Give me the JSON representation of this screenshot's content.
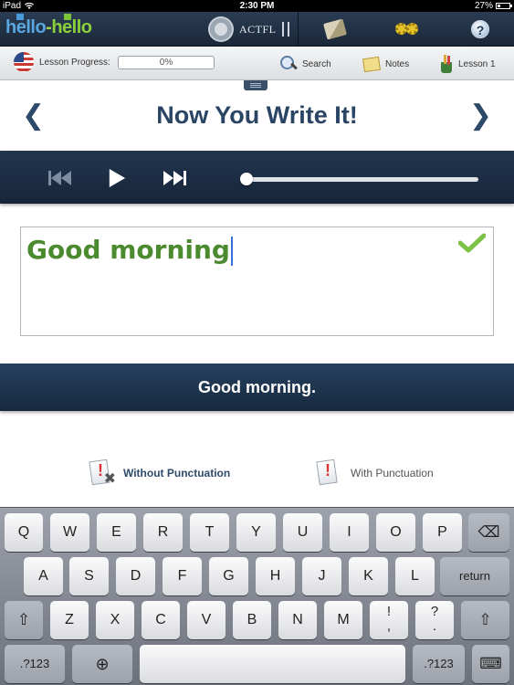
{
  "status_bar": {
    "device": "iPad",
    "time": "2:30 PM",
    "battery": "27%"
  },
  "top_nav": {
    "logo_part1": "hello",
    "logo_dash": "-",
    "logo_part2": "hello",
    "actfl_label": "ACTFL",
    "tabs": [
      {
        "icon": "book-icon"
      },
      {
        "icon": "gears-icon"
      },
      {
        "icon": "help-icon",
        "glyph": "?"
      }
    ]
  },
  "toolbar": {
    "flag_icon": "us-flag-icon",
    "lesson_progress_label": "Lesson Progress:",
    "progress_text": "0%",
    "progress_value": 0,
    "search_label": "Search",
    "notes_label": "Notes",
    "lesson_label": "Lesson 1"
  },
  "header": {
    "prev_arrow": "❮",
    "title": "Now You Write It!",
    "next_arrow": "❯"
  },
  "player": {
    "position": 0
  },
  "answer": {
    "typed_text": "Good morning",
    "status": "correct"
  },
  "correct_answer": "Good morning.",
  "punctuation": {
    "without_label": "Without Punctuation",
    "with_label": "With Punctuation",
    "selected": "without"
  },
  "keyboard": {
    "row1": [
      "Q",
      "W",
      "E",
      "R",
      "T",
      "Y",
      "U",
      "I",
      "O",
      "P"
    ],
    "row2": [
      "A",
      "S",
      "D",
      "F",
      "G",
      "H",
      "J",
      "K",
      "L"
    ],
    "row3": [
      "Z",
      "X",
      "C",
      "V",
      "B",
      "N",
      "M"
    ],
    "return_label": "return",
    "exclaim_top": "!",
    "exclaim_bottom": ",",
    "question_top": "?",
    "question_bottom": ".",
    "numbers_label": ".?123",
    "shift_glyph": "⇧",
    "globe_glyph": "⊕",
    "backspace_glyph": "⌫",
    "hide_glyph": "⌨"
  }
}
